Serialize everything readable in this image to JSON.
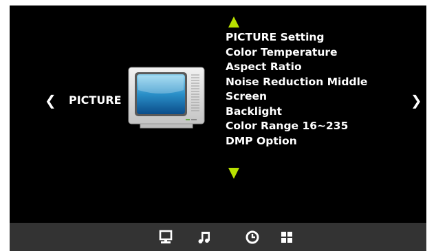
{
  "nav": {
    "prev_glyph": "❮",
    "next_glyph": "❯",
    "category_label": "PICTURE",
    "category_icon": "tv-icon"
  },
  "menu": {
    "up_icon": "up-arrow-icon",
    "down_icon": "down-arrow-icon",
    "items": [
      "PICTURE Setting",
      "Color Temperature",
      "Aspect Ratio",
      "Noise Reduction Middle",
      "Screen",
      "Backlight",
      "Color Range 16~235",
      "DMP Option"
    ]
  },
  "bottom_bar": {
    "icons": [
      "monitor-icon",
      "music-note-icon",
      "clock-icon",
      "grid-icon"
    ]
  },
  "colors": {
    "screen_bg": "#000000",
    "arrow_accent": "#b8e000",
    "bottom_bar_bg": "#333333",
    "text": "#ffffff"
  }
}
